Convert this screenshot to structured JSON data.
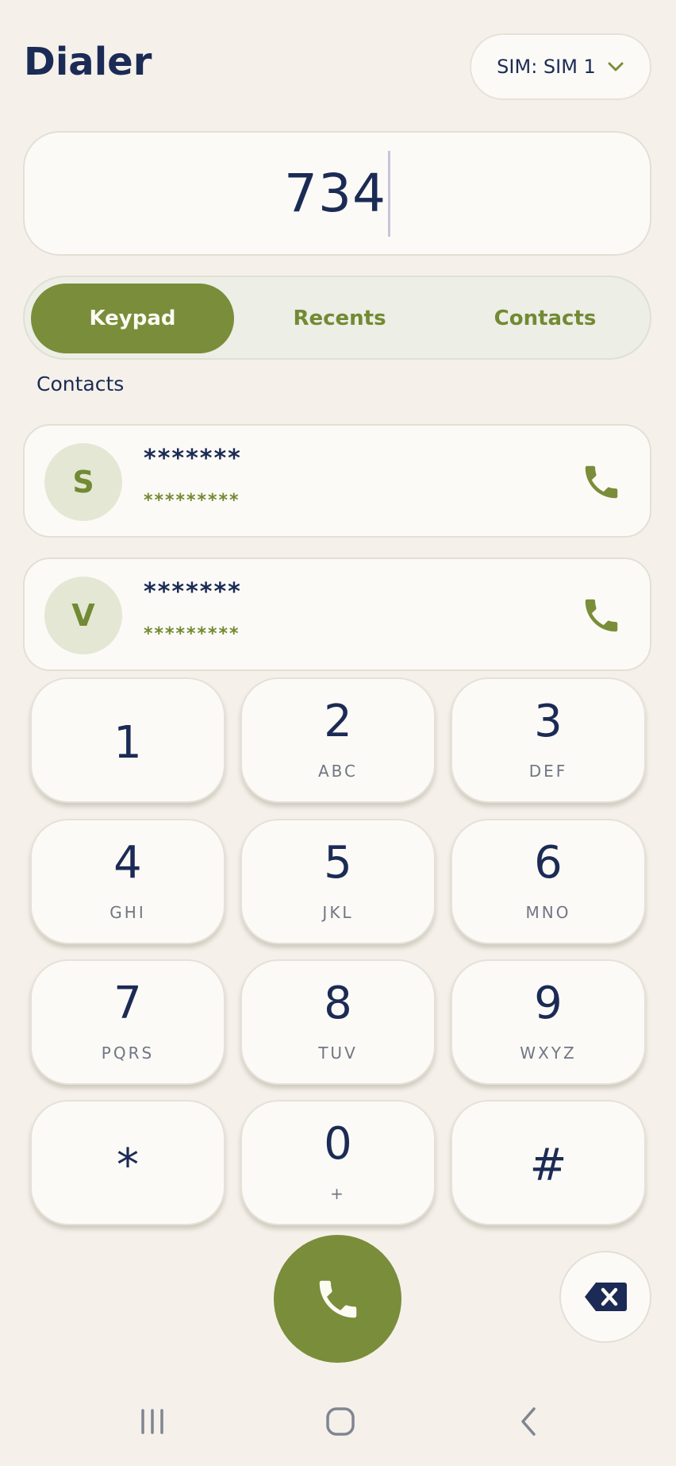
{
  "header": {
    "title": "Dialer",
    "sim_label": "SIM: SIM 1"
  },
  "dial_input": {
    "value": "734"
  },
  "tabs": [
    {
      "label": "Keypad",
      "active": true
    },
    {
      "label": "Recents",
      "active": false
    },
    {
      "label": "Contacts",
      "active": false
    }
  ],
  "contacts_section": {
    "label": "Contacts",
    "items": [
      {
        "initial": "S",
        "name": "*******",
        "number": "*********"
      },
      {
        "initial": "V",
        "name": "*******",
        "number": "*********"
      }
    ]
  },
  "keypad": [
    {
      "digit": "1",
      "letters": ""
    },
    {
      "digit": "2",
      "letters": "ABC"
    },
    {
      "digit": "3",
      "letters": "DEF"
    },
    {
      "digit": "4",
      "letters": "GHI"
    },
    {
      "digit": "5",
      "letters": "JKL"
    },
    {
      "digit": "6",
      "letters": "MNO"
    },
    {
      "digit": "7",
      "letters": "PQRS"
    },
    {
      "digit": "8",
      "letters": "TUV"
    },
    {
      "digit": "9",
      "letters": "WXYZ"
    },
    {
      "digit": "*",
      "letters": ""
    },
    {
      "digit": "0",
      "letters": "+"
    },
    {
      "digit": "#",
      "letters": ""
    }
  ],
  "colors": {
    "accent": "#7a8d3a",
    "text_primary": "#1b2b55",
    "background": "#f5f1ea",
    "card": "#fcfaf6"
  },
  "icons": {
    "sim_dropdown": "chevron-down-icon",
    "contact_call": "phone-icon",
    "call": "phone-icon",
    "delete": "backspace-icon",
    "nav_recent": "recent-apps-icon",
    "nav_home": "home-icon",
    "nav_back": "back-icon"
  }
}
